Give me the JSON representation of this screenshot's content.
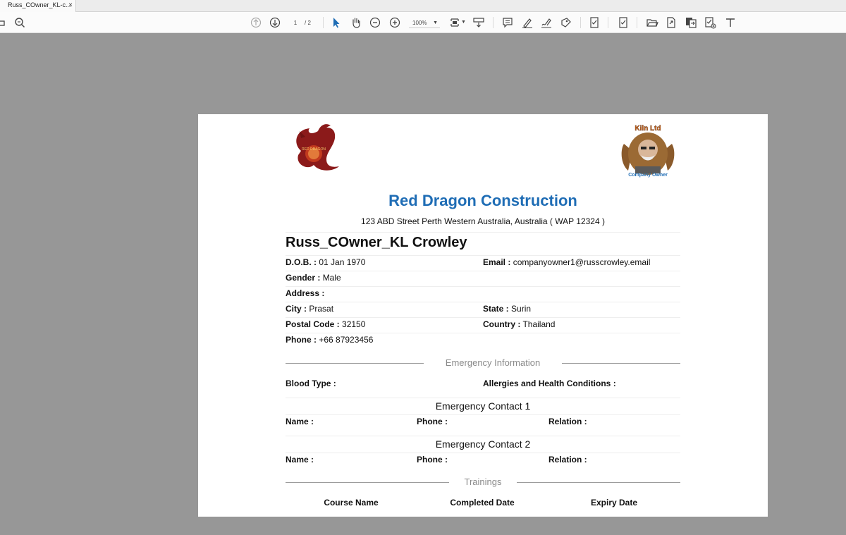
{
  "tab": {
    "title": "Russ_COwner_KL-c...",
    "close": "×"
  },
  "toolbar": {
    "page_current": "1",
    "page_total": "/ 2",
    "zoom": "100%",
    "icons": [
      "prev-page-icon",
      "next-page-icon",
      "select-tool-icon",
      "hand-tool-icon",
      "zoom-out-icon",
      "zoom-in-icon",
      "fit-page-icon",
      "scroll-mode-icon",
      "comment-icon",
      "highlight-icon",
      "sign-icon",
      "stamp-icon",
      "fill-sign-icon",
      "review-icon",
      "open-file-icon",
      "export-icon",
      "compare-icon",
      "edit-pdf-icon",
      "text-tool-icon"
    ]
  },
  "document": {
    "company_name": "Red Dragon Construction",
    "company_address": "123 ABD Street Perth Western Australia, Australia ( WAP 12324 )",
    "person_name": "Russ_COwner_KL Crowley",
    "logo_left_text": "RED DRAGON",
    "logo_right_top_text": "Kiln Ltd",
    "logo_right_bottom_text": "Company Owner",
    "fields": {
      "dob": {
        "label": "D.O.B. :",
        "value": "01 Jan 1970"
      },
      "email": {
        "label": "Email :",
        "value": "companyowner1@russcrowley.email"
      },
      "gender": {
        "label": "Gender :",
        "value": "Male"
      },
      "address": {
        "label": "Address :",
        "value": ""
      },
      "city": {
        "label": "City :",
        "value": "Prasat"
      },
      "state": {
        "label": "State :",
        "value": "Surin"
      },
      "postal": {
        "label": "Postal Code :",
        "value": "32150"
      },
      "country": {
        "label": "Country :",
        "value": "Thailand"
      },
      "phone": {
        "label": "Phone :",
        "value": "+66 87923456"
      }
    },
    "emergency": {
      "title": "Emergency Information",
      "blood_type_label": "Blood Type :",
      "allergies_label": "Allergies and Health Conditions :",
      "contact1_title": "Emergency Contact 1",
      "contact2_title": "Emergency Contact 2",
      "name_label": "Name :",
      "phone_label": "Phone :",
      "relation_label": "Relation :"
    },
    "trainings": {
      "title": "Trainings",
      "columns": [
        "Course Name",
        "Completed Date",
        "Expiry Date"
      ]
    }
  },
  "colors": {
    "accent": "#1f6db5",
    "viewer_bg": "#979797",
    "logo_red": "#8b1a1a"
  }
}
